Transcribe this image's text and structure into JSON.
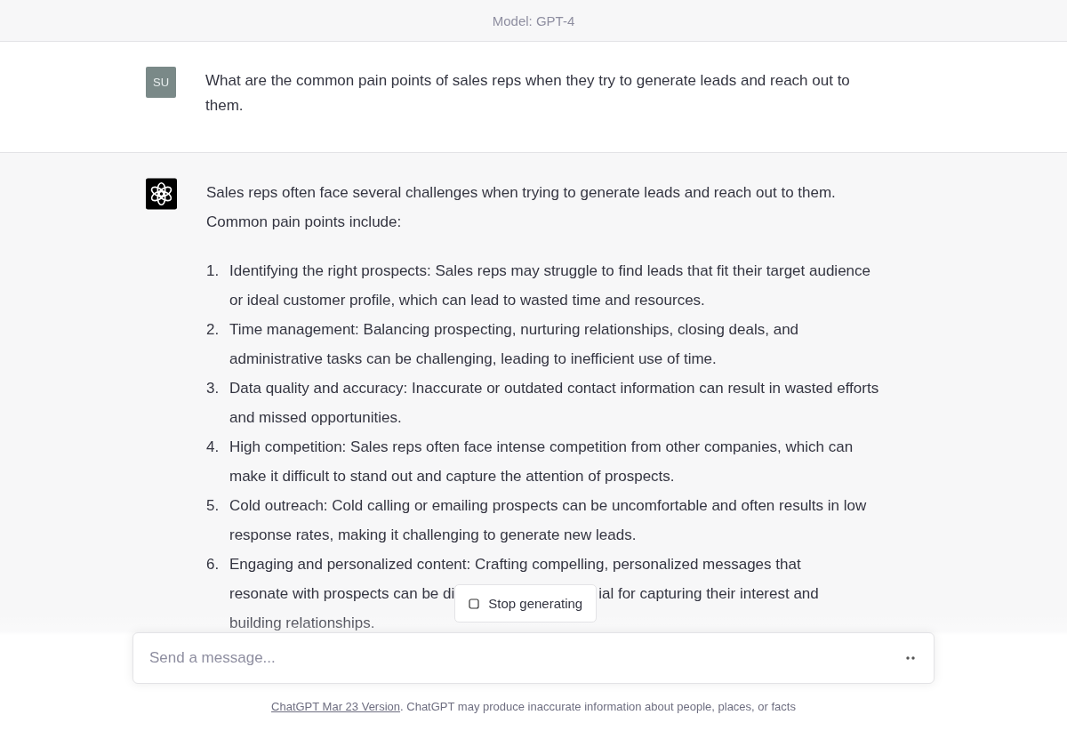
{
  "header": {
    "title": "Model: GPT-4"
  },
  "messages": [
    {
      "kind": "user",
      "avatar": "SU",
      "text": "What are the common pain points of sales reps when they try to generate leads and reach out to them."
    },
    {
      "kind": "assistant",
      "intro": "Sales reps often face several challenges when trying to generate leads and reach out to them. Common pain points include:",
      "items": [
        {
          "number": "1.",
          "text": "Identifying the right prospects: Sales reps may struggle to find leads that fit their target audience or ideal customer profile, which can lead to wasted time and resources."
        },
        {
          "number": "2.",
          "text": "Time management: Balancing prospecting, nurturing relationships, closing deals, and administrative tasks can be challenging, leading to inefficient use of time."
        },
        {
          "number": "3.",
          "text": "Data quality and accuracy: Inaccurate or outdated contact information can result in wasted efforts and missed opportunities."
        },
        {
          "number": "4.",
          "text": "High competition: Sales reps often face intense competition from other companies, which can make it difficult to stand out and capture the attention of prospects."
        },
        {
          "number": "5.",
          "text": "Cold outreach: Cold calling or emailing prospects can be uncomfortable and often results in low response rates, making it challenging to generate new leads."
        },
        {
          "number": "6.",
          "lines": [
            {
              "before": "Engaging and personalized content: Crafting compelling, personalized messages that"
            },
            {
              "before": "resonate with prospects can be di",
              "after": "ial for capturing their interest and"
            },
            {
              "before": "building relationships."
            }
          ]
        }
      ]
    }
  ],
  "stop_button": {
    "label": "Stop generating"
  },
  "composer": {
    "placeholder": "Send a message..."
  },
  "footer": {
    "link": "ChatGPT Mar 23 Version",
    "text": ". ChatGPT may produce inaccurate information about people, places, or facts"
  }
}
